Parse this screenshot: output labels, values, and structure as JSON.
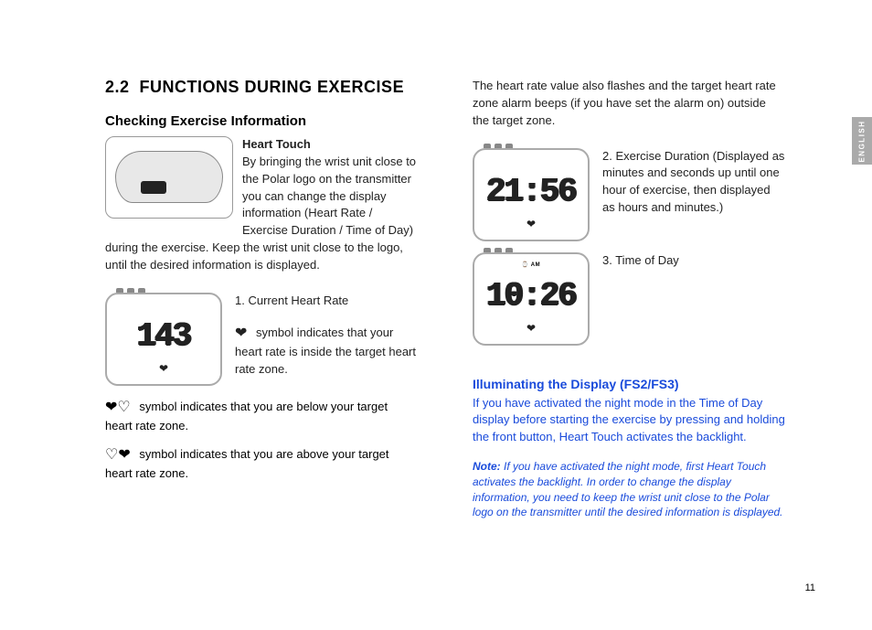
{
  "section": {
    "number": "2.2",
    "title": "FUNCTIONS DURING EXERCISE"
  },
  "check": {
    "heading": "Checking Exercise Information",
    "heartTouchLabel": "Heart Touch",
    "heartTouchBody": "By bringing the wrist unit close to the Polar logo on the transmitter you can change the display information (Heart Rate / Exercise Duration / Time of Day) during the exercise. Keep the wrist unit close to the logo, until the desired information is displayed."
  },
  "watches": {
    "hr": {
      "value": "143",
      "ampm": ""
    },
    "dur": {
      "value": "21:56",
      "ampm": ""
    },
    "tod": {
      "value": "10:26",
      "ampm": "⌚ AM"
    }
  },
  "items": {
    "i1": "1.  Current Heart Rate",
    "i1b": " symbol indicates that your heart rate is inside the target heart rate zone.",
    "below": " symbol indicates that you are below your target heart rate zone.",
    "above": " symbol indicates that you are above your target heart rate zone.",
    "rightIntro": "The heart rate value also flashes and the target heart rate zone alarm beeps (if you have set the alarm on) outside the target zone.",
    "i2": "2.  Exercise Duration (Displayed as minutes and seconds up until one hour of exercise, then displayed as hours and minutes.)",
    "i3": "3.  Time of Day"
  },
  "illum": {
    "heading": "Illuminating the Display (FS2/FS3)",
    "body": "If you have activated the night mode in the Time of Day display before starting the exercise by pressing and holding the front button, Heart Touch activates the backlight.",
    "noteLabel": "Note:",
    "noteBody": " If you have activated the night mode, first Heart Touch activates the backlight. In order to change the display information, you need to keep the wrist unit close to the Polar logo on the transmitter until the desired information is displayed."
  },
  "sideTab": "ENGLISH",
  "pageNumber": "11",
  "heartFilled": "❤",
  "heartOutline": "♡"
}
